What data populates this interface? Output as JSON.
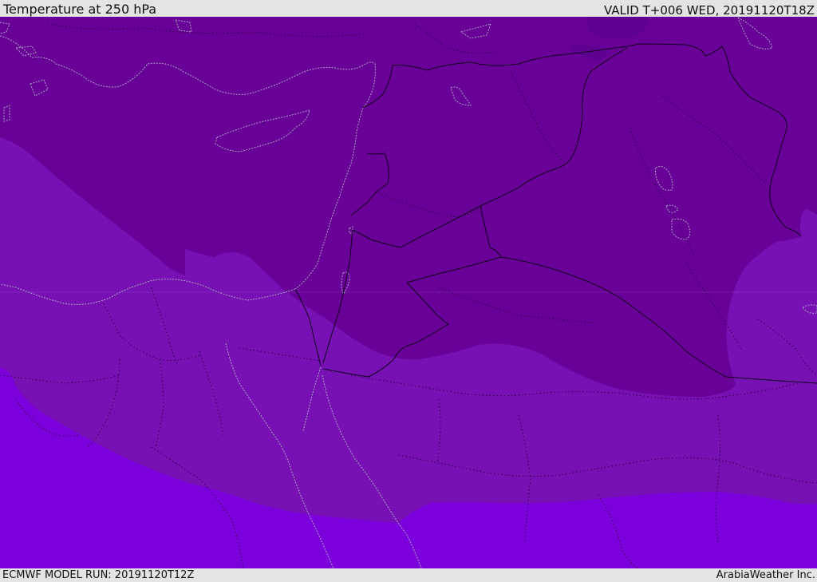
{
  "header": {
    "title": "Temperature at 250 hPa",
    "valid": "VALID T+006 WED, 20191120T18Z"
  },
  "footer": {
    "model_run": "ECMWF MODEL RUN: 20191120T12Z",
    "credit": "ArabiaWeather Inc."
  },
  "colors": {
    "coldest": "#5e0090",
    "cold": "#690097",
    "mid": "#7711b4",
    "warm": "#7b00db",
    "border": "#1b0030",
    "coast": "#a8a8c0",
    "header_bg": "#e4e4e4"
  }
}
